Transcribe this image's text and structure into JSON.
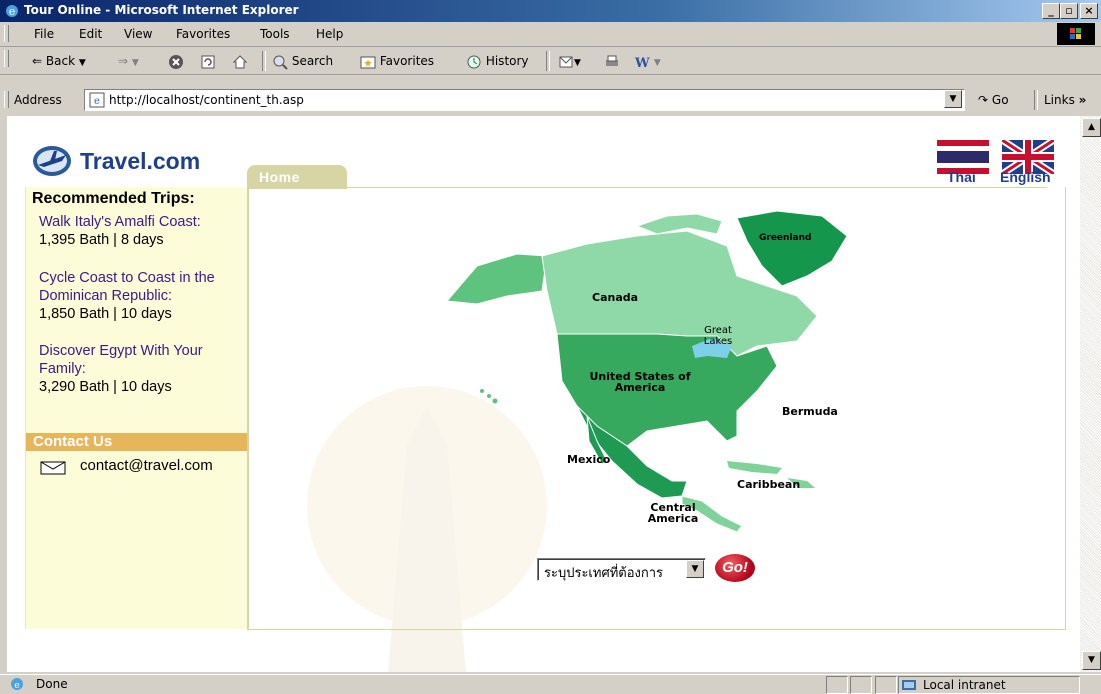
{
  "window": {
    "title": "Tour Online - Microsoft Internet Explorer"
  },
  "menu": [
    "File",
    "Edit",
    "View",
    "Favorites",
    "Tools",
    "Help"
  ],
  "toolbar": {
    "back": "Back",
    "search": "Search",
    "favorites": "Favorites",
    "history": "History"
  },
  "address": {
    "label": "Address",
    "url": "http://localhost/continent_th.asp",
    "go": "Go",
    "links": "Links"
  },
  "page": {
    "logo": "Travel.com",
    "home_tab": "Home",
    "lang_thai": "Thai",
    "lang_english": "English",
    "recommended_title": "Recommended Trips:",
    "trips": [
      {
        "name": "Walk Italy's Amalfi Coast:",
        "info": "1,395 Bath | 8 days"
      },
      {
        "name": "Cycle Coast to Coast in the Dominican Republic:",
        "info": "1,850 Bath | 10 days"
      },
      {
        "name": "Discover Egypt With Your Family:",
        "info": "3,290 Bath | 10 days"
      }
    ],
    "contact_title": "Contact Us",
    "contact_email": "contact@travel.com",
    "map_labels": {
      "greenland": "Greenland",
      "canada": "Canada",
      "great_lakes": "Great Lakes",
      "usa": "United States of America",
      "bermuda": "Bermuda",
      "mexico": "Mexico",
      "caribbean": "Caribbean",
      "central_america": "Central America"
    },
    "country_select": "ระบุประเทศที่ต้องการ",
    "go_button": "Go!"
  },
  "status": {
    "text": "Done",
    "zone": "Local intranet"
  },
  "colors": {
    "titlebar": "#0a246a",
    "canada": "#7fd39a",
    "usa": "#2fa85a",
    "greenland": "#0e8f45",
    "contact": "#e7b55a",
    "sidebar": "#fdfcd8"
  }
}
